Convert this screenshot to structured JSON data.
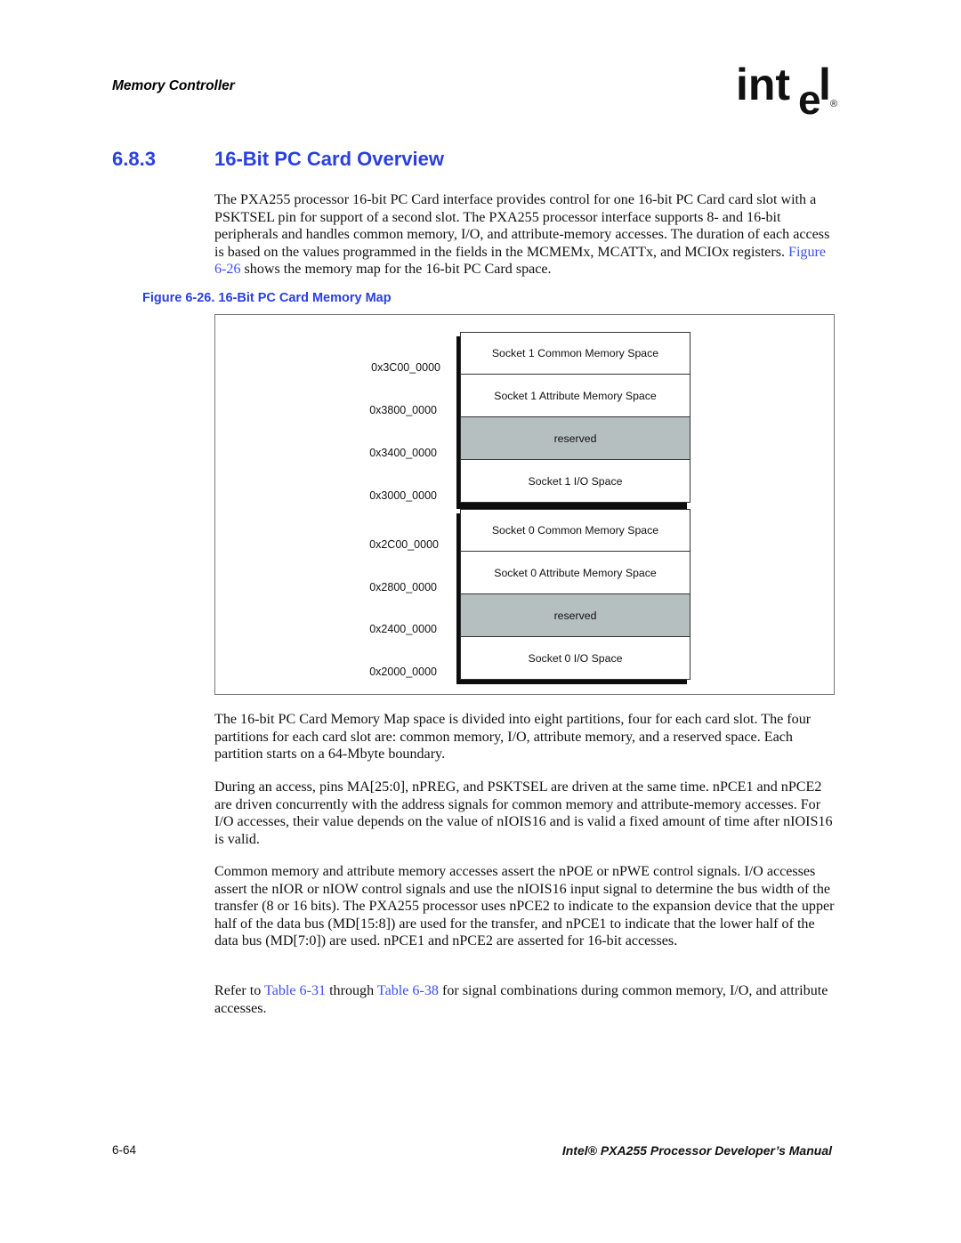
{
  "header": {
    "section": "Memory Controller",
    "logo": {
      "icon": "intel-logo-icon",
      "text": "int",
      "e": "e",
      "l": "l",
      "registered": "®"
    }
  },
  "heading": {
    "number": "6.8.3",
    "title": "16-Bit PC Card Overview"
  },
  "intro_paragraph": {
    "before_link": "The PXA255 processor 16-bit PC Card interface provides control for one 16-bit PC Card card slot with a PSKTSEL pin for support of a second slot. The PXA255 processor interface supports 8- and 16-bit peripherals and handles common memory, I/O, and attribute-memory accesses. The duration of each access is based on the values programmed in the fields in the MCMEMx, MCATTx, and MCIOx registers. ",
    "link": "Figure 6-26",
    "after_link": " shows the memory map for the 16-bit PC Card space."
  },
  "figure": {
    "caption": "Figure 6-26. 16-Bit PC Card Memory Map",
    "addresses": [
      "0x3C00_0000",
      "0x3800_0000",
      "0x3400_0000",
      "0x3000_0000",
      "0x2C00_0000",
      "0x2800_0000",
      "0x2400_0000",
      "0x2000_0000"
    ],
    "socket1_blocks": [
      {
        "label": "Socket 1 Common Memory Space",
        "reserved": false
      },
      {
        "label": "Socket 1 Attribute Memory Space",
        "reserved": false
      },
      {
        "label": "reserved",
        "reserved": true
      },
      {
        "label": "Socket 1 I/O Space",
        "reserved": false
      }
    ],
    "socket0_blocks": [
      {
        "label": "Socket 0 Common Memory Space",
        "reserved": false
      },
      {
        "label": "Socket 0 Attribute Memory Space",
        "reserved": false
      },
      {
        "label": "reserved",
        "reserved": true
      },
      {
        "label": "Socket 0 I/O Space",
        "reserved": false
      }
    ],
    "colors": {
      "reserved_fill": "#b5bfbf",
      "shadow": "#0d0d0d"
    }
  },
  "paragraphs": [
    "The 16-bit PC Card Memory Map space is divided into eight partitions, four for each card slot. The four partitions for each card slot are: common memory, I/O, attribute memory, and a reserved space. Each partition starts on a 64-Mbyte boundary.",
    "During an access, pins MA[25:0], nPREG, and PSKTSEL are driven at the same time. nPCE1 and nPCE2 are driven concurrently with the address signals for common memory and attribute-memory accesses. For I/O accesses, their value depends on the value of nIOIS16 and is valid a fixed amount of time after nIOIS16 is valid.",
    "Common memory and attribute memory accesses assert the nPOE or nPWE control signals. I/O accesses assert the nIOR or nIOW control signals and use the nIOIS16 input signal to determine the bus width of the transfer (8 or 16 bits). The PXA255 processor uses nPCE2 to indicate to the expansion device that the upper half of the data bus (MD[15:8]) are used for the transfer, and nPCE1 to indicate that the lower half of the data bus (MD[7:0]) are used. nPCE1 and nPCE2 are asserted for 16-bit accesses."
  ],
  "refer_paragraph": {
    "p1": "Refer to ",
    "link1": "Table 6-31",
    "p2": " through ",
    "link2": "Table 6-38",
    "p3": " for signal combinations during common memory, I/O, and attribute accesses."
  },
  "footer": {
    "page_number": "6-64",
    "manual_title": "Intel® PXA255 Processor Developer’s Manual"
  },
  "colors": {
    "heading_blue": "#2a3fe0",
    "link_blue": "#3b4ff0"
  }
}
